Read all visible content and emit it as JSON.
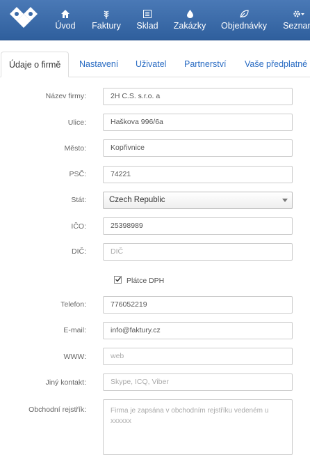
{
  "nav": {
    "items": [
      {
        "label": "Úvod",
        "icon": "home-icon"
      },
      {
        "label": "Faktury",
        "icon": "wheat-icon"
      },
      {
        "label": "Sklad",
        "icon": "list-icon"
      },
      {
        "label": "Zakázky",
        "icon": "drop-icon"
      },
      {
        "label": "Objednávky",
        "icon": "leaf-icon"
      },
      {
        "label": "Seznam",
        "icon": "gear-icon"
      }
    ]
  },
  "tabs": [
    "Údaje o firmě",
    "Nastavení",
    "Uživatel",
    "Partnerství",
    "Vaše předplatné"
  ],
  "form": {
    "company_name": {
      "label": "Název firmy:",
      "value": "2H C.S. s.r.o. a"
    },
    "street": {
      "label": "Ulice:",
      "value": "Haškova 996/6a"
    },
    "city": {
      "label": "Město:",
      "value": "Kopřivnice"
    },
    "zip": {
      "label": "PSČ:",
      "value": "74221"
    },
    "country": {
      "label": "Stát:",
      "value": "Czech Republic"
    },
    "ico": {
      "label": "IČO:",
      "value": "25398989"
    },
    "dic": {
      "label": "DIČ:",
      "placeholder": "DIČ"
    },
    "vat_payer": {
      "label": "Plátce DPH",
      "checked": true
    },
    "phone": {
      "label": "Telefon:",
      "value": "776052219"
    },
    "email": {
      "label": "E-mail:",
      "value": "info@faktury.cz"
    },
    "web": {
      "label": "WWW:",
      "placeholder": "web"
    },
    "other_contact": {
      "label": "Jiný kontakt:",
      "placeholder": "Skype, ICQ, Viber"
    },
    "register": {
      "label": "Obchodní rejstřík:",
      "placeholder": "Firma je zapsána v obchodním rejstříku vedeném u xxxxxx"
    }
  },
  "colors": {
    "topbar": "#3a6aa8",
    "link": "#2a6cc3"
  }
}
